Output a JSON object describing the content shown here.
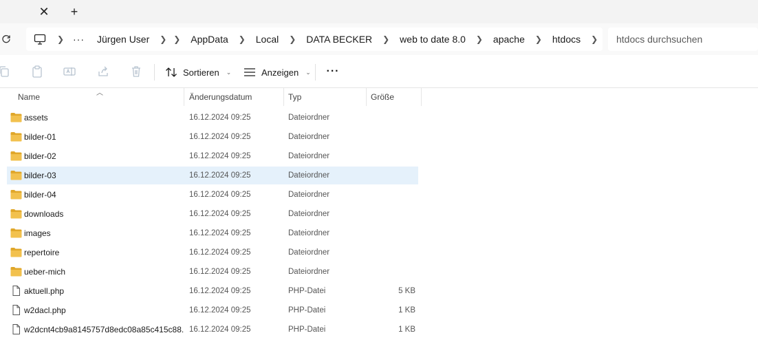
{
  "tabs": {
    "close_symbol": "✕",
    "new_symbol": "+"
  },
  "address": {
    "more_label": "···",
    "crumbs": [
      "Jürgen User",
      "AppData",
      "Local",
      "DATA BECKER",
      "web to date 8.0",
      "apache",
      "htdocs"
    ]
  },
  "search": {
    "placeholder": "htdocs durchsuchen"
  },
  "toolbar": {
    "sort_label": "Sortieren",
    "view_label": "Anzeigen",
    "more_label": "···"
  },
  "columns": {
    "name": "Name",
    "date": "Änderungsdatum",
    "type": "Typ",
    "size": "Größe"
  },
  "files": [
    {
      "name": "assets",
      "date": "16.12.2024 09:25",
      "type": "Dateiordner",
      "size": "",
      "kind": "folder"
    },
    {
      "name": "bilder-01",
      "date": "16.12.2024 09:25",
      "type": "Dateiordner",
      "size": "",
      "kind": "folder"
    },
    {
      "name": "bilder-02",
      "date": "16.12.2024 09:25",
      "type": "Dateiordner",
      "size": "",
      "kind": "folder"
    },
    {
      "name": "bilder-03",
      "date": "16.12.2024 09:25",
      "type": "Dateiordner",
      "size": "",
      "kind": "folder",
      "selected": true
    },
    {
      "name": "bilder-04",
      "date": "16.12.2024 09:25",
      "type": "Dateiordner",
      "size": "",
      "kind": "folder"
    },
    {
      "name": "downloads",
      "date": "16.12.2024 09:25",
      "type": "Dateiordner",
      "size": "",
      "kind": "folder"
    },
    {
      "name": "images",
      "date": "16.12.2024 09:25",
      "type": "Dateiordner",
      "size": "",
      "kind": "folder"
    },
    {
      "name": "repertoire",
      "date": "16.12.2024 09:25",
      "type": "Dateiordner",
      "size": "",
      "kind": "folder"
    },
    {
      "name": "ueber-mich",
      "date": "16.12.2024 09:25",
      "type": "Dateiordner",
      "size": "",
      "kind": "folder"
    },
    {
      "name": "aktuell.php",
      "date": "16.12.2024 09:25",
      "type": "PHP-Datei",
      "size": "5 KB",
      "kind": "file"
    },
    {
      "name": "w2dacl.php",
      "date": "16.12.2024 09:25",
      "type": "PHP-Datei",
      "size": "1 KB",
      "kind": "file"
    },
    {
      "name": "w2dcnt4cb9a8145757d8edc08a85c415c88...",
      "date": "16.12.2024 09:25",
      "type": "PHP-Datei",
      "size": "1 KB",
      "kind": "file"
    }
  ],
  "colors": {
    "folder": "#f2c14e",
    "folder_dark": "#e0a72a",
    "selection": "#e5f1fb",
    "toolbar_icon_disabled": "#b8c4d0"
  }
}
